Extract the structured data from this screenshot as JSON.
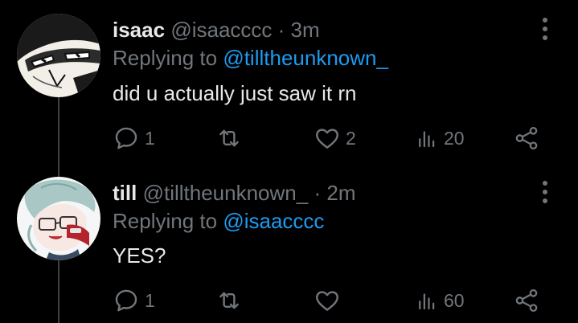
{
  "colors": {
    "background": "#000000",
    "primary_text": "#e7e9ea",
    "secondary_text": "#71767b",
    "link": "#1d9bf0",
    "thread_line": "#3e4144"
  },
  "icons": [
    "reply-icon",
    "retweet-icon",
    "heart-icon",
    "views-icon",
    "share-icon",
    "more-vertical-icon"
  ],
  "tweets": [
    {
      "display_name": "isaac",
      "handle": "@isaacccc",
      "separator": "·",
      "time": "3m",
      "replying_prefix": "Replying to",
      "replying_to": "@tilltheunknown_",
      "text": "did u actually just saw it rn",
      "reply_count": "1",
      "retweet_count": "",
      "like_count": "2",
      "view_count": "20"
    },
    {
      "display_name": "till",
      "handle": "@tilltheunknown_",
      "separator": "·",
      "time": "2m",
      "replying_prefix": "Replying to",
      "replying_to": "@isaacccc",
      "text": "YES?",
      "reply_count": "1",
      "retweet_count": "",
      "like_count": "",
      "view_count": "60"
    }
  ]
}
